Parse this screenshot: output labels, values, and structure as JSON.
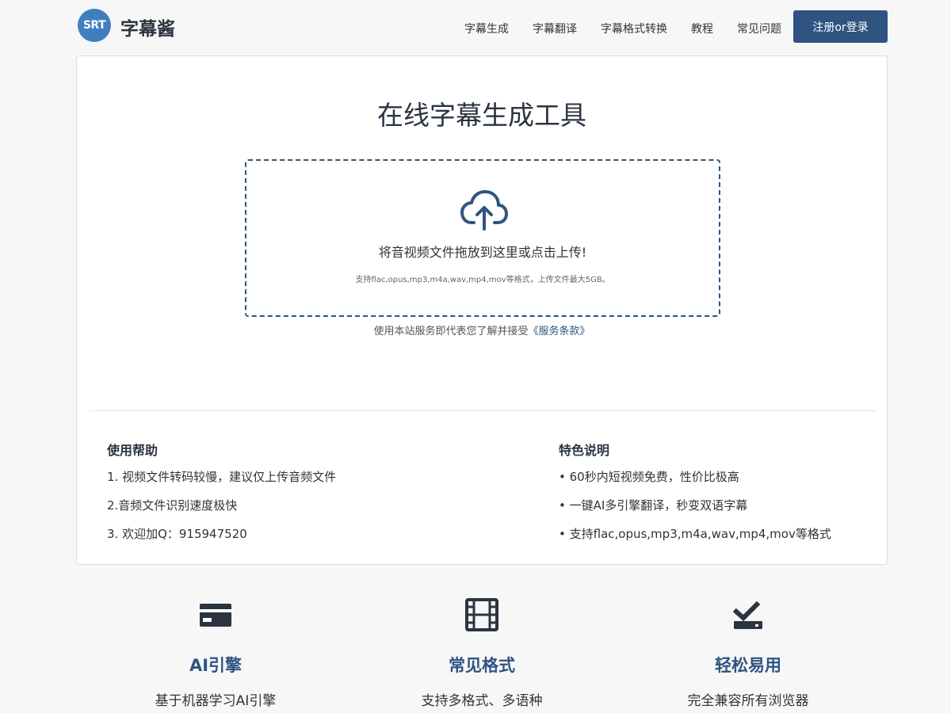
{
  "header": {
    "logo_text": "SRT",
    "brand": "字幕酱",
    "nav": [
      "字幕生成",
      "字幕翻译",
      "字幕格式转换",
      "教程",
      "常见问题"
    ],
    "login_label": "注册or登录"
  },
  "main": {
    "title": "在线字幕生成工具",
    "dropzone": {
      "icon": "cloud-upload-icon",
      "text": "将音视频文件拖放到这里或点击上传!",
      "hint": "支持flac,opus,mp3,m4a,wav,mp4,mov等格式，上传文件最大5GB。"
    },
    "terms_prefix": "使用本站服务即代表您了解并接受",
    "terms_link": "《服务条款》",
    "help": {
      "title": "使用帮助",
      "items": [
        "1. 视频文件转码较慢，建议仅上传音频文件",
        "2.音频文件识别速度极快",
        "3. 欢迎加Q：915947520"
      ]
    },
    "features_info": {
      "title": "特色说明",
      "items": [
        "• 60秒内短视频免费，性价比极高",
        "• 一键AI多引擎翻译，秒变双语字幕",
        "• 支持flac,opus,mp3,m4a,wav,mp4,mov等格式"
      ]
    }
  },
  "features": [
    {
      "icon": "credit-card-icon",
      "title": "AI引擎",
      "desc": "基于机器学习AI引擎"
    },
    {
      "icon": "film-icon",
      "title": "常见格式",
      "desc": "支持多格式、多语种"
    },
    {
      "icon": "check-tray-icon",
      "title": "轻松易用",
      "desc": "完全兼容所有浏览器"
    }
  ],
  "colors": {
    "accent": "#2f5482",
    "logo": "#3f7fbf",
    "text": "#2b3440"
  }
}
